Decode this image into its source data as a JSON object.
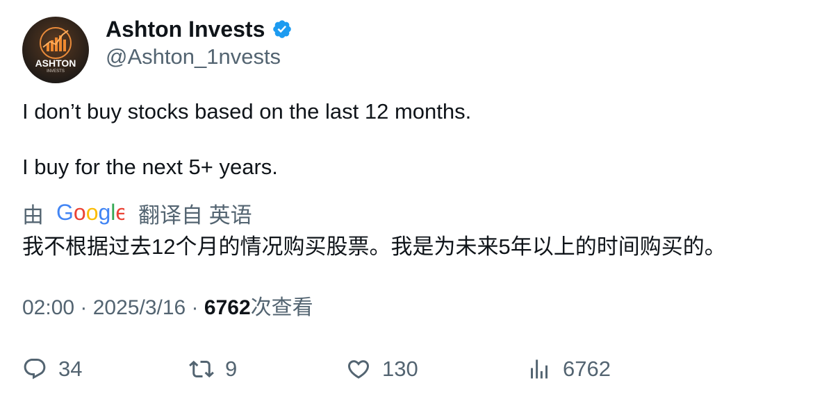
{
  "author": {
    "display_name": "Ashton Invests",
    "handle": "@Ashton_1nvests",
    "verified": true,
    "avatar_text": "ASHTON",
    "avatar_subtext": "INVESTS",
    "verified_icon": "verified-badge-icon"
  },
  "tweet": {
    "lines": [
      "I don’t buy stocks based on the last 12 months.",
      "I buy for the next 5+ years."
    ]
  },
  "translation": {
    "prefix": "由",
    "provider": "Google",
    "from_label": "翻译自 英语",
    "text": "我不根据过去12个月的情况购买股票。我是为未来5年以上的时间购买的。"
  },
  "meta": {
    "time": "02:00",
    "separator": " · ",
    "date": "2025/3/16",
    "views_count": "6762",
    "views_label": "次查看"
  },
  "actions": {
    "replies": "34",
    "retweets": "9",
    "likes": "130",
    "views": "6762"
  },
  "colors": {
    "text_primary": "#0f1419",
    "text_secondary": "#536471",
    "verified_blue": "#1d9bf0",
    "google_blue": "#4285f4",
    "google_red": "#ea4335",
    "google_yellow": "#fbbc05",
    "google_green": "#34a853"
  }
}
